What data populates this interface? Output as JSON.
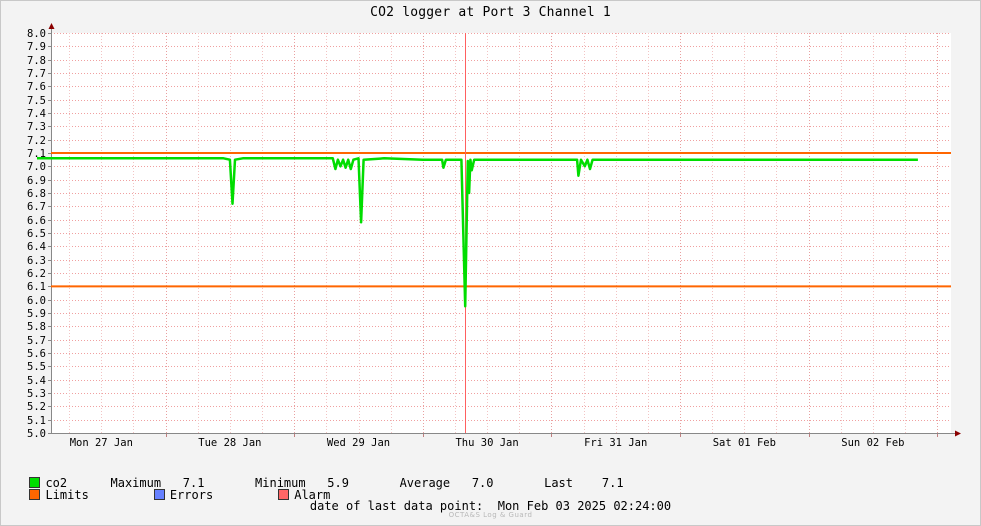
{
  "chart_data": {
    "type": "line",
    "title": "CO2 logger at Port 3 Channel 1",
    "ylim": [
      5.0,
      8.0
    ],
    "y_ticks": [
      "5.0",
      "5.1",
      "5.2",
      "5.3",
      "5.4",
      "5.5",
      "5.6",
      "5.7",
      "5.8",
      "5.9",
      "6.0",
      "6.1",
      "6.2",
      "6.3",
      "6.4",
      "6.5",
      "6.6",
      "6.7",
      "6.8",
      "6.9",
      "7.0",
      "7.1",
      "7.2",
      "7.3",
      "7.4",
      "7.5",
      "7.6",
      "7.7",
      "7.8",
      "7.9",
      "8.0"
    ],
    "x_ticks": [
      "Mon 27 Jan",
      "Tue 28 Jan",
      "Wed 29 Jan",
      "Thu 30 Jan",
      "Fri 31 Jan",
      "Sat 01 Feb",
      "Sun 02 Feb"
    ],
    "grid": true,
    "limits": {
      "upper": 7.1,
      "lower": 6.1,
      "color": "#ff6600"
    },
    "series": [
      {
        "name": "co2",
        "color": "#00dd00",
        "points": [
          [
            0,
            7.06
          ],
          [
            0.5,
            7.06
          ],
          [
            1.0,
            7.06
          ],
          [
            1.45,
            7.06
          ],
          [
            1.5,
            7.05
          ],
          [
            1.52,
            6.72
          ],
          [
            1.54,
            7.05
          ],
          [
            1.6,
            7.06
          ],
          [
            2.0,
            7.06
          ],
          [
            2.3,
            7.06
          ],
          [
            2.32,
            6.98
          ],
          [
            2.34,
            7.05
          ],
          [
            2.36,
            7.0
          ],
          [
            2.38,
            7.05
          ],
          [
            2.4,
            6.99
          ],
          [
            2.42,
            7.05
          ],
          [
            2.44,
            6.98
          ],
          [
            2.46,
            7.05
          ],
          [
            2.5,
            7.06
          ],
          [
            2.52,
            6.58
          ],
          [
            2.54,
            7.05
          ],
          [
            2.7,
            7.06
          ],
          [
            3.0,
            7.05
          ],
          [
            3.15,
            7.05
          ],
          [
            3.16,
            6.99
          ],
          [
            3.18,
            7.05
          ],
          [
            3.3,
            7.05
          ],
          [
            3.33,
            5.95
          ],
          [
            3.35,
            7.04
          ],
          [
            3.36,
            6.8
          ],
          [
            3.37,
            7.05
          ],
          [
            3.38,
            6.97
          ],
          [
            3.4,
            7.05
          ],
          [
            4.0,
            7.05
          ],
          [
            4.2,
            7.05
          ],
          [
            4.21,
            6.93
          ],
          [
            4.23,
            7.05
          ],
          [
            4.26,
            7.0
          ],
          [
            4.28,
            7.05
          ],
          [
            4.3,
            6.98
          ],
          [
            4.32,
            7.05
          ],
          [
            5.0,
            7.05
          ],
          [
            6.0,
            7.05
          ],
          [
            6.85,
            7.05
          ]
        ]
      }
    ],
    "marker_line_at": 3.33
  },
  "legend": {
    "co2_label": "co2",
    "maximum_label": "Maximum",
    "maximum_value": "7.1",
    "minimum_label": "Minimum",
    "minimum_value": "5.9",
    "average_label": "Average",
    "average_value": "7.0",
    "last_label": "Last",
    "last_value": "7.1",
    "limits_label": "Limits",
    "errors_label": "Errors",
    "alarm_label": "Alarm",
    "co2_color": "#00dd00",
    "limits_color": "#ff6600",
    "errors_color": "#6680ff",
    "alarm_color": "#ff6666"
  },
  "footer": {
    "last_point_label": "date of last data point:",
    "last_point_value": "Mon Feb 03 2025 02:24:00",
    "watermark": "OCTA&S Log & Guard"
  }
}
